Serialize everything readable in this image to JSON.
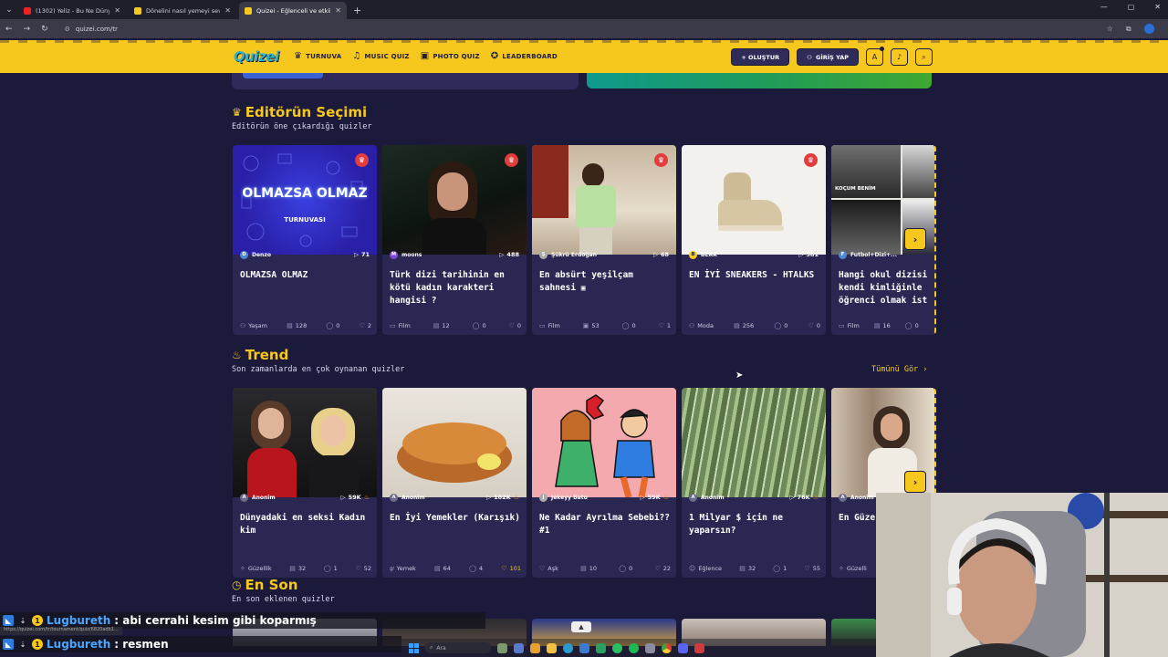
{
  "browser": {
    "tabs": [
      {
        "title": "(1302) Yeliz - Bu Ne Dünya Kardeşim",
        "favicon_color": "#e22",
        "active": false
      },
      {
        "title": "Dönelini nasıl yemeyi seversin?",
        "favicon_color": "#f6c81e",
        "active": false
      },
      {
        "title": "Quizei - Eğlenceli ve etkileşimli",
        "favicon_color": "#f6c81e",
        "active": true
      }
    ],
    "url": "quizei.com/tr"
  },
  "site": {
    "logo": "Quizei",
    "nav": [
      {
        "label": "TURNUVA",
        "icon": "trophy-icon"
      },
      {
        "label": "MUSIC QUIZ",
        "icon": "music-icon"
      },
      {
        "label": "PHOTO QUIZ",
        "icon": "camera-icon"
      },
      {
        "label": "LEADERBOARD",
        "icon": "medal-icon"
      }
    ],
    "create_label": "+ OLUŞTUR",
    "login_label": "GİRİŞ YAP"
  },
  "editor": {
    "title": "Editörün Seçimi",
    "subtitle": "Editörün öne çıkardığı quizler",
    "cards": [
      {
        "author": "Denzo",
        "plays": "71",
        "title": "OLMAZSA OLMAZ",
        "category": "Yaşam",
        "questions": "128",
        "comments": "0",
        "likes": "2",
        "thumb_text": "OLMAZSA OLMAZ",
        "thumb_sub": "TURNUVASI"
      },
      {
        "author": "moons",
        "plays": "488",
        "title": "Türk dizi tarihinin en kötü kadın karakteri hangisi ?",
        "category": "Film",
        "questions": "12",
        "comments": "0",
        "likes": "0"
      },
      {
        "author": "Şükrü Erdoğan",
        "plays": "68",
        "title": "En absürt yeşilçam sahnesi",
        "category": "Film",
        "questions": "53",
        "comments": "0",
        "likes": "1"
      },
      {
        "author": "BERK",
        "plays": "381",
        "title": "EN İYİ SNEAKERS - HTALKS",
        "category": "Moda",
        "questions": "256",
        "comments": "0",
        "likes": "0"
      },
      {
        "author": "Futbol+Dizi+...",
        "plays": "",
        "title": "Hangi okul dizisi kendi kimliğinle öğrenci olmak ist",
        "category": "Film",
        "questions": "16",
        "comments": "0",
        "likes": "",
        "thumb_text": "KOÇUM BENİM"
      }
    ]
  },
  "trend": {
    "title": "Trend",
    "subtitle": "Son zamanlarda en çok oynanan quizler",
    "see_all": "Tümünü Gör ›",
    "cards": [
      {
        "author": "Anonim",
        "plays": "59K",
        "title": "Dünyadaki en seksi Kadın kim",
        "category": "Güzellik",
        "questions": "32",
        "comments": "1",
        "likes": "52"
      },
      {
        "author": "Anonim",
        "plays": "102K",
        "title": "En İyi Yemekler (Karışık)",
        "category": "Yemek",
        "questions": "64",
        "comments": "4",
        "likes": "101"
      },
      {
        "author": "Jekeyy Batu",
        "plays": "59K",
        "title": "Ne Kadar Ayrılma Sebebi?? #1",
        "category": "Aşk",
        "questions": "10",
        "comments": "0",
        "likes": "22"
      },
      {
        "author": "Anonim",
        "plays": "76K",
        "title": "1 Milyar $ için ne yaparsın?",
        "category": "Eğlence",
        "questions": "32",
        "comments": "1",
        "likes": "55"
      },
      {
        "author": "Anonim",
        "plays": "",
        "title": "En Güze",
        "category": "Güzelli",
        "questions": "",
        "comments": "",
        "likes": ""
      }
    ]
  },
  "latest": {
    "title": "En Son",
    "subtitle": "En son eklenen quizler"
  },
  "chat": [
    {
      "user": "Lugbureth",
      "message": ": abi cerrahi kesim gibi koparmış"
    },
    {
      "user": "Lugbureth",
      "message": ": resmen"
    }
  ],
  "status_url": "https://quizei.com/tr/tournament/quiz/6820adb1...",
  "taskbar": {
    "search_placeholder": "Ara"
  }
}
